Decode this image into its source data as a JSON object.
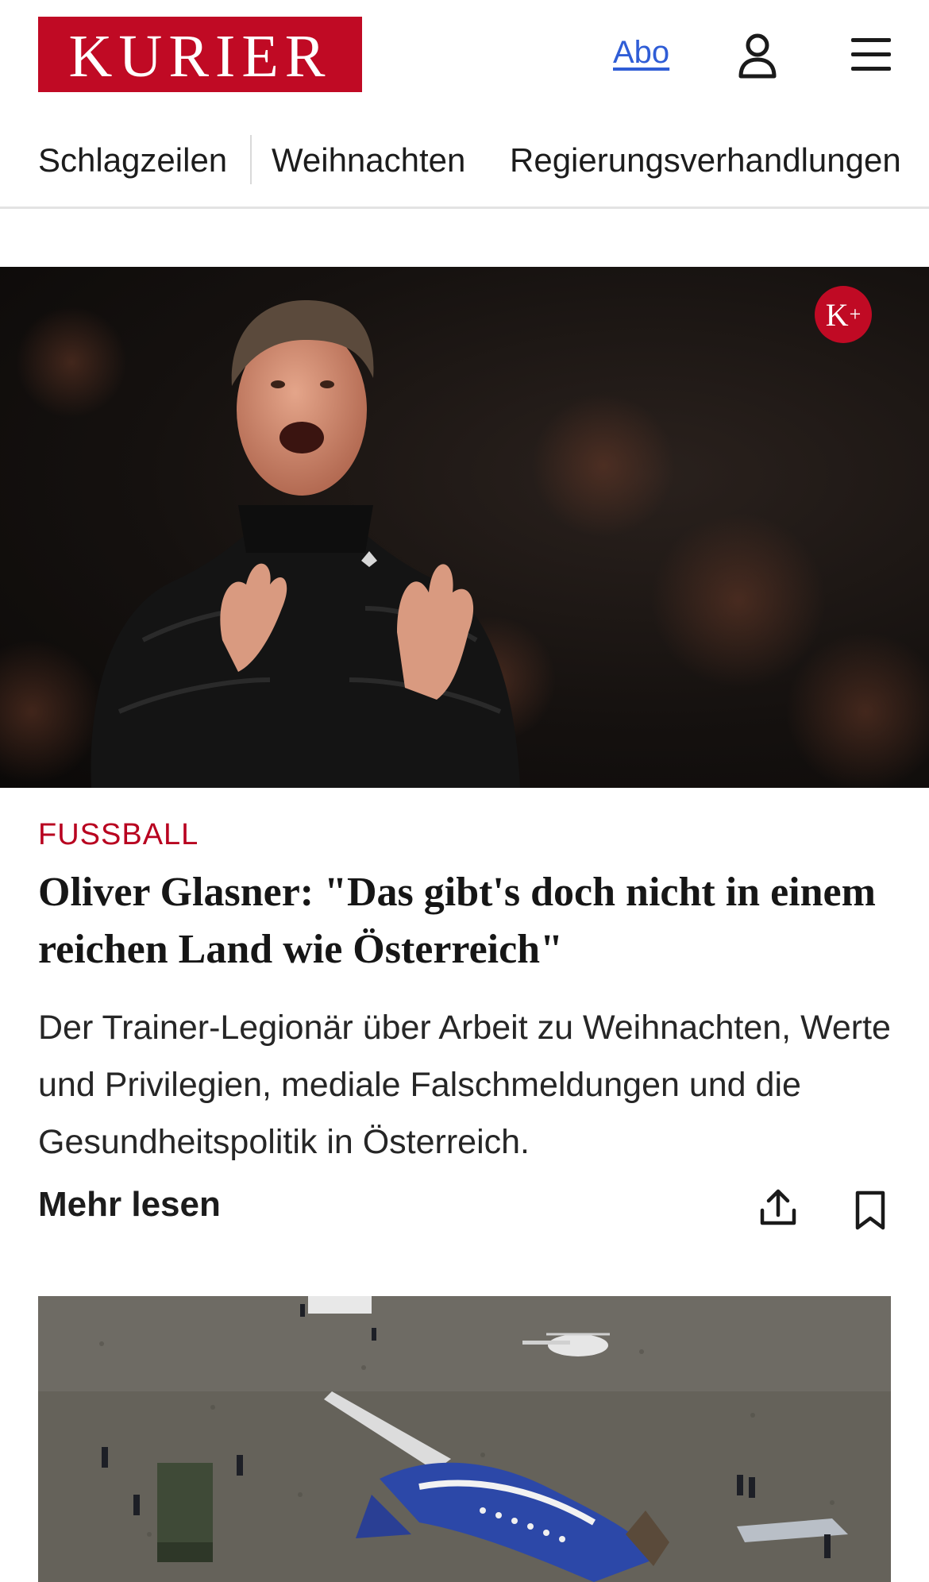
{
  "header": {
    "logo_text": "KURIER",
    "abo_label": "Abo",
    "user_icon": "user-icon",
    "menu_icon": "hamburger-menu-icon"
  },
  "nav": {
    "items": [
      {
        "label": "Schlagzeilen"
      },
      {
        "label": "Weihnachten"
      },
      {
        "label": "Regierungsverhandlungen"
      }
    ]
  },
  "hero": {
    "badge_letter": "K",
    "badge_plus": "+"
  },
  "article": {
    "category": "FUSSBALL",
    "headline": "Oliver Glasner: \"Das gibt's doch nicht in einem reichen Land wie Österreich\"",
    "teaser": "Der Trainer-Legionär über Arbeit zu Weihnachten, Werte und Privilegien, mediale Falschmeldungen und die Gesundheitspolitik in Österreich.",
    "more_label": "Mehr lesen",
    "share_icon": "share-icon",
    "bookmark_icon": "bookmark-icon"
  },
  "colors": {
    "brand_red": "#c00a24",
    "category_red": "#b8001f",
    "link_blue": "#2f5dd6",
    "divider": "#e3e3e3"
  }
}
